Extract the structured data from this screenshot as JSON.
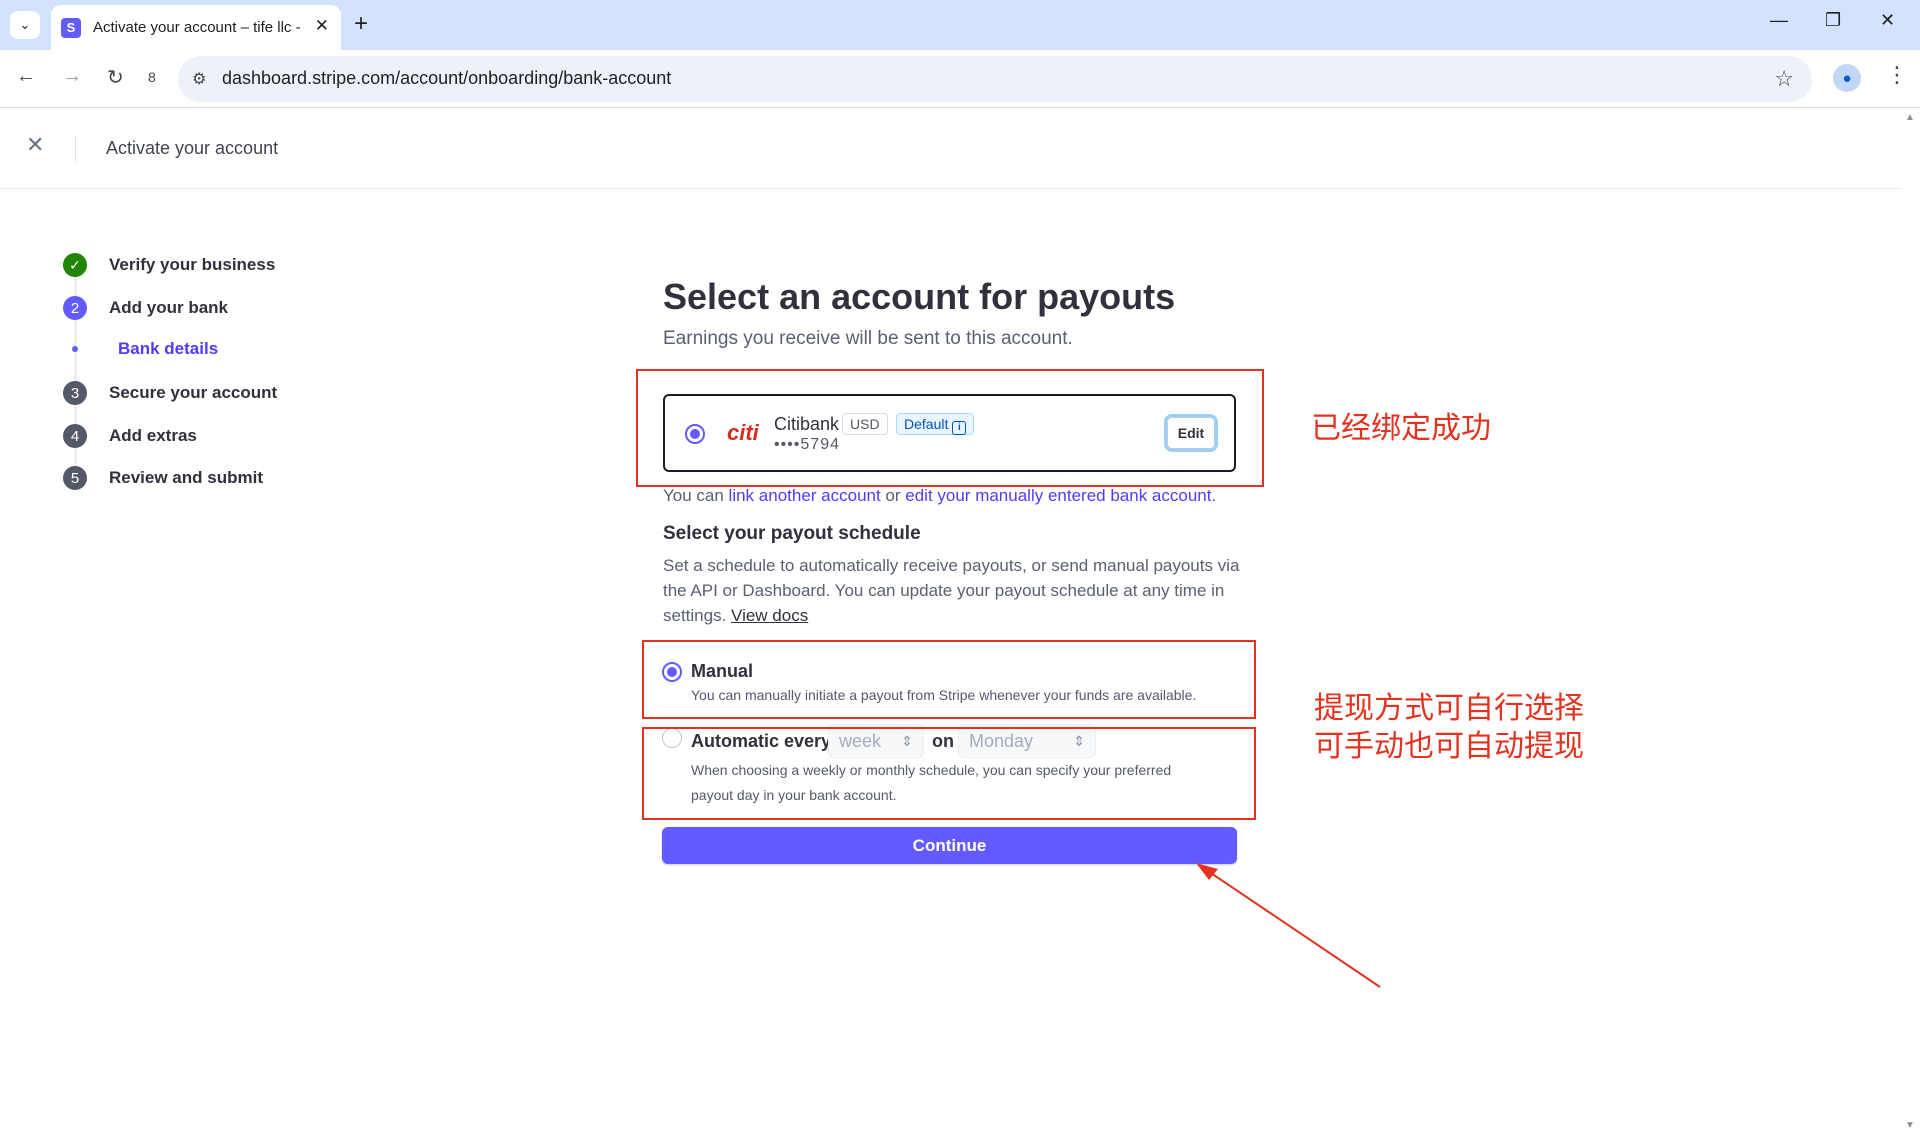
{
  "browser": {
    "tab_title": "Activate your account – tife llc -",
    "favicon_letter": "S",
    "url": "dashboard.stripe.com/account/onboarding/bank-account",
    "nav_count": "8"
  },
  "header": {
    "title": "Activate your account"
  },
  "steps": [
    {
      "label": "Verify your business",
      "marker": "✓",
      "state": "done"
    },
    {
      "label": "Add your bank",
      "marker": "2",
      "state": "active"
    },
    {
      "label": "Bank details",
      "marker": "",
      "state": "substep"
    },
    {
      "label": "Secure your account",
      "marker": "3",
      "state": "pending"
    },
    {
      "label": "Add extras",
      "marker": "4",
      "state": "pending"
    },
    {
      "label": "Review and submit",
      "marker": "5",
      "state": "pending"
    }
  ],
  "main": {
    "title": "Select an account for payouts",
    "subtitle": "Earnings you receive will be sent to this account.",
    "bank": {
      "logo": "citi",
      "name": "Citibank",
      "currency": "USD",
      "default_badge": "Default",
      "masked_number": "••••5794",
      "edit_label": "Edit"
    },
    "link_line": {
      "prefix": "You can ",
      "link1": "link another account",
      "middle": " or ",
      "link2": "edit your manually entered bank account",
      "suffix": "."
    },
    "schedule": {
      "title": "Select your payout schedule",
      "desc": "Set a schedule to automatically receive payouts, or send manual payouts via the API or Dashboard. You can update your payout schedule at any time in settings. ",
      "docs_link": "View docs",
      "manual_label": "Manual",
      "manual_desc": "You can manually initiate a payout from Stripe whenever your funds are available.",
      "auto_label": "Automatic every",
      "interval_value": "week",
      "on_label": "on",
      "day_value": "Monday",
      "auto_desc": "When choosing a weekly or monthly schedule, you can specify your preferred payout day in your bank account.",
      "selected": "manual"
    },
    "continue_label": "Continue"
  },
  "annotations": {
    "bound": "已经绑定成功",
    "choice_line1": "提现方式可自行选择",
    "choice_line2": "可手动也可自动提现"
  },
  "colors": {
    "accent": "#635bff",
    "annotation": "#e3321f",
    "success": "#228403"
  }
}
